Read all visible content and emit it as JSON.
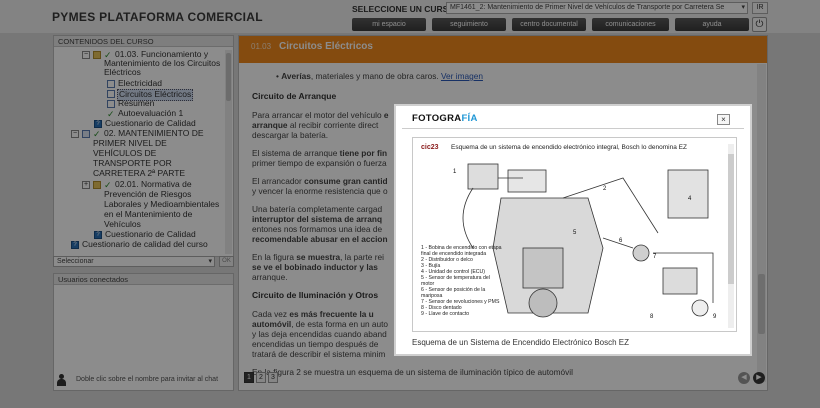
{
  "header": {
    "brand": "PYMES PLATAFORMA COMERCIAL",
    "course_label": "SELECCIONE UN CURSO:",
    "course_value": "MF1461_2: Mantenimiento de Primer Nivel de Vehículos de Transporte por Carretera Se",
    "go_label": "IR",
    "nav": [
      "mi espacio",
      "seguimiento",
      "centro documental",
      "comunicaciones",
      "ayuda"
    ]
  },
  "sidebar": {
    "title": "CONTENIDOS DEL CURSO",
    "tree": [
      "01.03. Funcionamiento y",
      "Mantenimiento de los Circuitos",
      "Eléctricos",
      "Electricidad",
      "Circuitos Eléctricos",
      "Resumen",
      "Autoevaluación 1",
      "Cuestionario de Calidad",
      "02. MANTENIMIENTO DE",
      "PRIMER NIVEL DE",
      "VEHÍCULOS DE",
      "TRANSPORTE POR",
      "CARRETERA 2ª PARTE",
      "02.01. Normativa de",
      "Prevención de Riesgos",
      "Laborales y Medioambientales",
      "en el Mantenimiento de",
      "Vehículos",
      "Cuestionario de Calidad",
      "Cuestionario de calidad del curso"
    ],
    "select_label": "Seleccionar",
    "ok_label": "OK",
    "users_title": "Usuarios conectados",
    "chat_hint": "Doble clic sobre el nombre para invitar al chat"
  },
  "content": {
    "section_num": "01.03",
    "section_title": "Circuitos Eléctricos",
    "bullet_bold": "Averías",
    "bullet_rest": ", materiales y mano de obra caros.",
    "bullet_link": "Ver imagen",
    "h_arranque": "Circuito de Arranque",
    "p1a": "Para arrancar el motor del vehículo ",
    "p1b": "e",
    "p2a": "arranque",
    "p2b": " al recibir corriente direct",
    "p3": "descargar la batería.",
    "p4a": "El sistema de arranque ",
    "p4b": "tiene por fin",
    "p5": "primer tiempo de expansión o fuerza",
    "p6a": "El arrancador ",
    "p6b": "consume gran cantid",
    "p7": "y vencer la enorme resistencia que o",
    "p8": "Una batería completamente cargad",
    "p9a": "interruptor del sistema de arranq",
    "p10": "entones nos formamos una idea de ",
    "p11": "recomendable abusar en el accion",
    "p12a": "En la figura ",
    "p12b": "se muestra",
    "p12c": ", la parte rei",
    "p13": "se ve el bobinado inductor y las",
    "p14": "arranque.",
    "h_ilum": "Circuito de Iluminación y Otros",
    "p15a": "Cada vez ",
    "p15b": "es más frecuente la u",
    "p16a": "automóvil",
    "p16b": ", de esta forma en un auto",
    "p17": "y las deja encendidas cuando aband",
    "p18": "encendidas un tiempo después de",
    "p19": "tratará de describir el sistema minim",
    "p20": "En la figura 2 se muestra un esquema de un sistema de iluminación típico de automóvil",
    "pages": [
      "1",
      "2",
      "3"
    ]
  },
  "modal": {
    "logo_a": "FOTOGRA",
    "logo_b": "FÍA",
    "close": "×",
    "fig_tag": "cic23",
    "fig_title": "Esquema de un sistema de encendido electrónico integral, Bosch lo denomina EZ",
    "legend": [
      "1 - Bobina de encendido con etapa",
      "     final de encendido integrada",
      "2 - Distribuidor o delco",
      "3 - Bujía",
      "4 - Unidad de control (ECU)",
      "5 - Sensor de temperatura del",
      "     motor",
      "6 - Sensor de posición de la",
      "     mariposa",
      "7 - Sensor de revoluciones y PMS",
      "8 - Disco dentado",
      "9 - Llave de contacto"
    ],
    "caption": "Esquema de un Sistema de Encendido Electrónico Bosch EZ"
  },
  "colors": {
    "accent": "#f0891c",
    "link": "#2a59b8",
    "logo_accent": "#1f97d6"
  }
}
